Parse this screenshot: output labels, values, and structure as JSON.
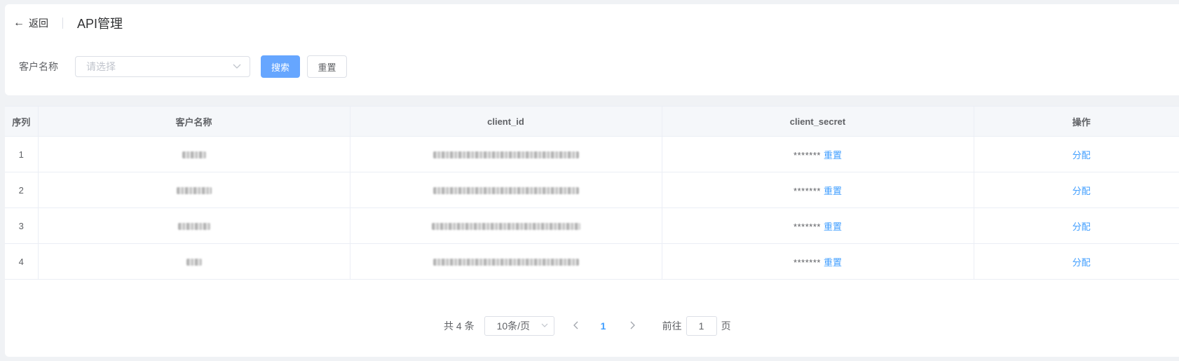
{
  "header": {
    "back_label": "返回",
    "title": "API管理"
  },
  "filter": {
    "label": "客户名称",
    "placeholder": "请选择",
    "search_label": "搜索",
    "reset_label": "重置"
  },
  "table": {
    "columns": [
      "序列",
      "客户名称",
      "client_id",
      "client_secret",
      "操作"
    ],
    "rows": [
      {
        "index": "1",
        "secret_mask": "*******",
        "reset_label": "重置",
        "action_label": "分配"
      },
      {
        "index": "2",
        "secret_mask": "*******",
        "reset_label": "重置",
        "action_label": "分配"
      },
      {
        "index": "3",
        "secret_mask": "*******",
        "reset_label": "重置",
        "action_label": "分配"
      },
      {
        "index": "4",
        "secret_mask": "*******",
        "reset_label": "重置",
        "action_label": "分配"
      }
    ]
  },
  "pagination": {
    "total_text": "共 4 条",
    "page_size": "10条/页",
    "current_page": "1",
    "goto_prefix": "前往",
    "goto_value": "1",
    "goto_suffix": "页"
  },
  "colors": {
    "primary": "#409eff",
    "primary_button": "#66a6ff",
    "page_bg": "#f0f2f5"
  },
  "icons": [
    "arrow-left-icon",
    "chevron-down-icon",
    "chevron-left-icon",
    "chevron-right-icon"
  ]
}
